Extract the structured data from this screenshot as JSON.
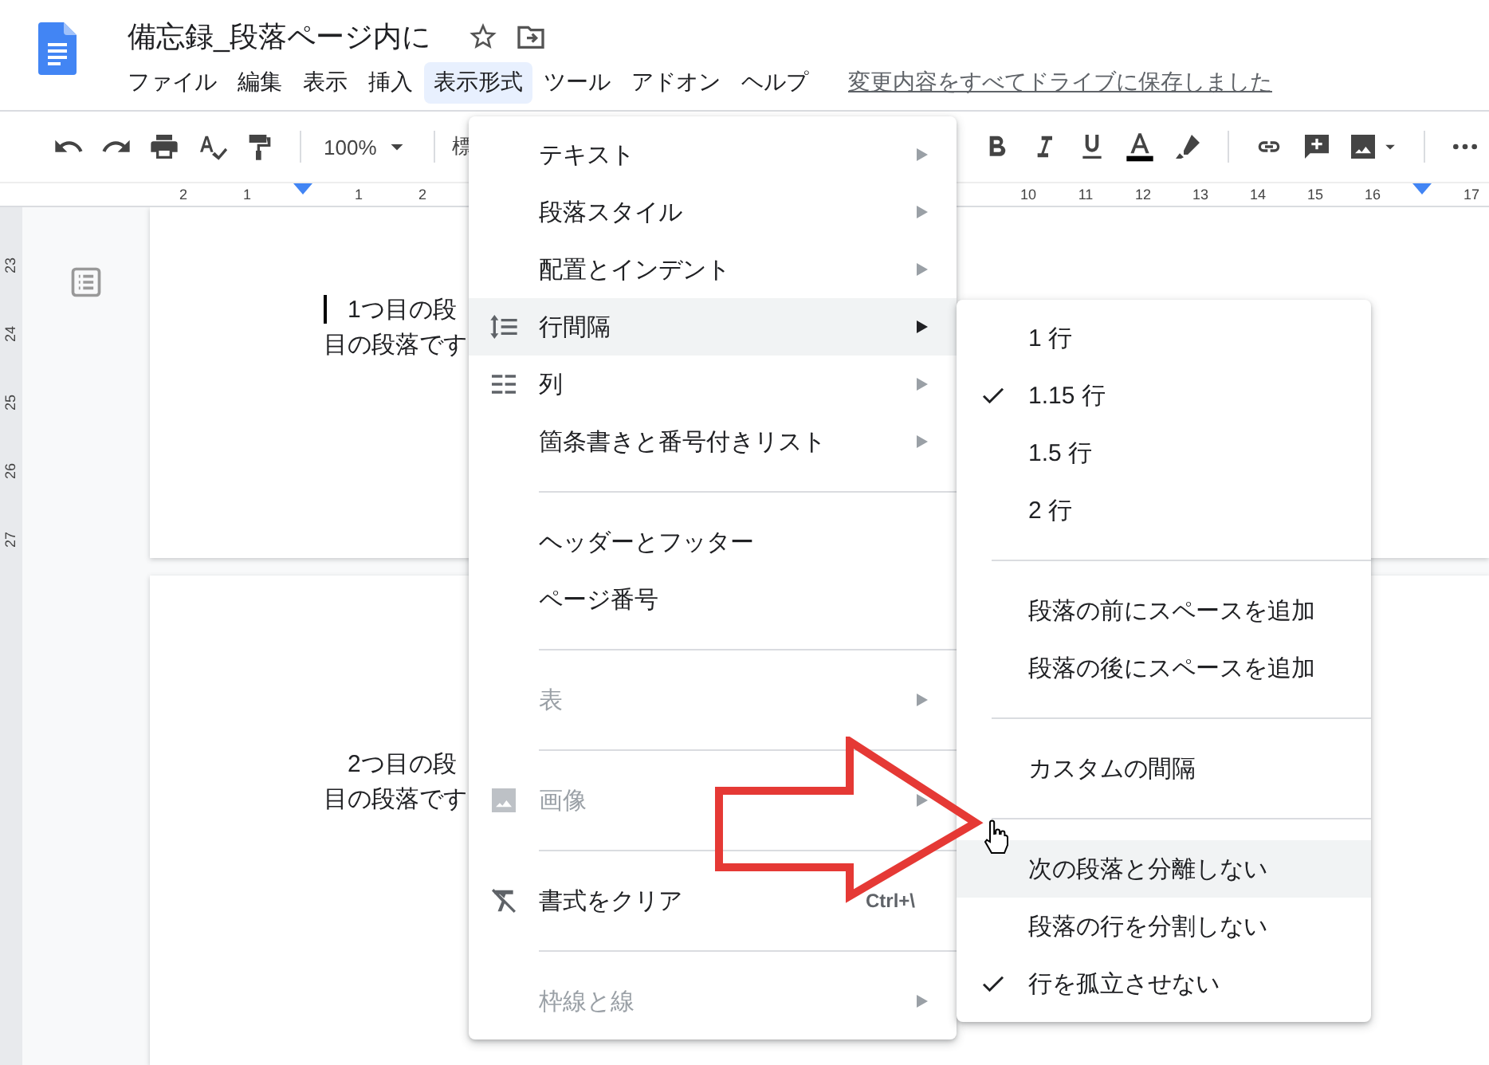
{
  "document": {
    "title": "備忘録_段落ページ内に",
    "starred": false
  },
  "menubar": [
    {
      "label": "ファイル",
      "selected": false
    },
    {
      "label": "編集",
      "selected": false
    },
    {
      "label": "表示",
      "selected": false
    },
    {
      "label": "挿入",
      "selected": false
    },
    {
      "label": "表示形式",
      "selected": true
    },
    {
      "label": "ツール",
      "selected": false
    },
    {
      "label": "アドオン",
      "selected": false
    },
    {
      "label": "ヘルプ",
      "selected": false
    }
  ],
  "save_status": "変更内容をすべてドライブに保存しました",
  "toolbar": {
    "zoom": "100%",
    "style": "標"
  },
  "ruler": {
    "left_marks": [
      "2",
      "1",
      "1",
      "2"
    ],
    "right_marks": [
      "10",
      "11",
      "12",
      "13",
      "14",
      "15",
      "16",
      "17"
    ],
    "vertical_marks": [
      "23",
      "24",
      "25",
      "26",
      "27"
    ]
  },
  "pages": [
    {
      "lines": [
        "1つ目の段",
        "目の段落です"
      ],
      "cursor": true
    },
    {
      "lines": [
        "2つ目の段",
        "目の段落です"
      ],
      "cursor": false
    }
  ],
  "format_menu": [
    {
      "kind": "item",
      "label": "テキスト",
      "submenu": true,
      "disabled": false,
      "highlighted": false
    },
    {
      "kind": "item",
      "label": "段落スタイル",
      "submenu": true,
      "disabled": false,
      "highlighted": false
    },
    {
      "kind": "item",
      "label": "配置とインデント",
      "submenu": true,
      "disabled": false,
      "highlighted": false
    },
    {
      "kind": "spacing",
      "label": "行間隔",
      "submenu": true,
      "disabled": false,
      "highlighted": true
    },
    {
      "kind": "columns",
      "label": "列",
      "submenu": true,
      "disabled": false,
      "highlighted": false
    },
    {
      "kind": "item",
      "label": "箇条書きと番号付きリスト",
      "submenu": true,
      "disabled": false,
      "highlighted": false
    },
    {
      "kind": "divider"
    },
    {
      "kind": "item",
      "label": "ヘッダーとフッター",
      "submenu": false,
      "disabled": false,
      "highlighted": false
    },
    {
      "kind": "item",
      "label": "ページ番号",
      "submenu": false,
      "disabled": false,
      "highlighted": false
    },
    {
      "kind": "divider"
    },
    {
      "kind": "item",
      "label": "表",
      "submenu": true,
      "disabled": true,
      "highlighted": false
    },
    {
      "kind": "divider"
    },
    {
      "kind": "image",
      "label": "画像",
      "submenu": true,
      "disabled": true,
      "highlighted": false
    },
    {
      "kind": "divider"
    },
    {
      "kind": "clear",
      "label": "書式をクリア",
      "shortcut": "Ctrl+\\",
      "submenu": false,
      "disabled": false,
      "highlighted": false
    },
    {
      "kind": "divider"
    },
    {
      "kind": "item",
      "label": "枠線と線",
      "submenu": true,
      "disabled": true,
      "highlighted": false
    }
  ],
  "line_spacing_menu": [
    {
      "kind": "item",
      "label": "1 行",
      "checked": false,
      "highlighted": false
    },
    {
      "kind": "item",
      "label": "1.15 行",
      "checked": true,
      "highlighted": false
    },
    {
      "kind": "item",
      "label": "1.5 行",
      "checked": false,
      "highlighted": false
    },
    {
      "kind": "item",
      "label": "2 行",
      "checked": false,
      "highlighted": false
    },
    {
      "kind": "divider"
    },
    {
      "kind": "item",
      "label": "段落の前にスペースを追加",
      "checked": false,
      "highlighted": false
    },
    {
      "kind": "item",
      "label": "段落の後にスペースを追加",
      "checked": false,
      "highlighted": false
    },
    {
      "kind": "divider"
    },
    {
      "kind": "item",
      "label": "カスタムの間隔",
      "checked": false,
      "highlighted": false
    },
    {
      "kind": "divider"
    },
    {
      "kind": "item",
      "label": "次の段落と分離しない",
      "checked": false,
      "highlighted": true
    },
    {
      "kind": "item",
      "label": "段落の行を分割しない",
      "checked": false,
      "highlighted": false
    },
    {
      "kind": "item",
      "label": "行を孤立させない",
      "checked": true,
      "highlighted": false
    }
  ]
}
